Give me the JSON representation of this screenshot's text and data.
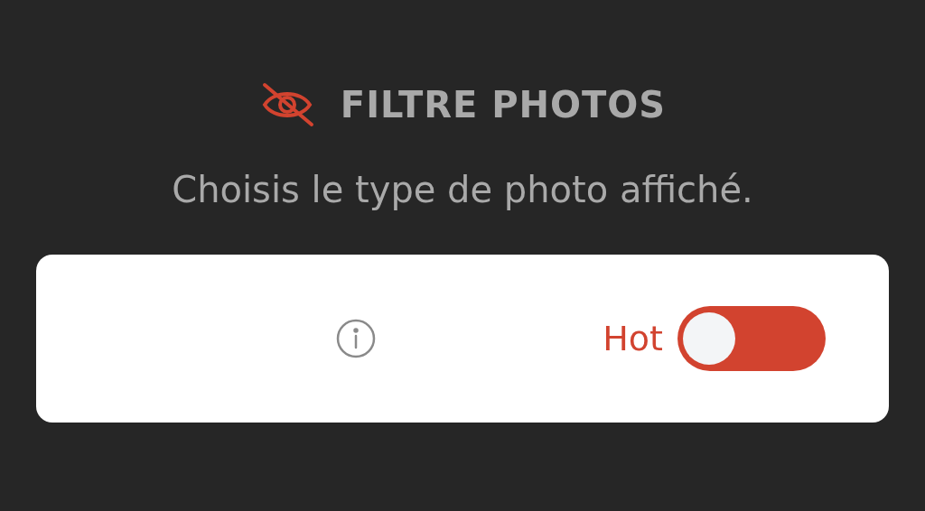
{
  "header": {
    "title": "FILTRE PHOTOS",
    "subtitle": "Choisis le type de photo affiché."
  },
  "filter": {
    "label": "Hot",
    "on": false
  }
}
